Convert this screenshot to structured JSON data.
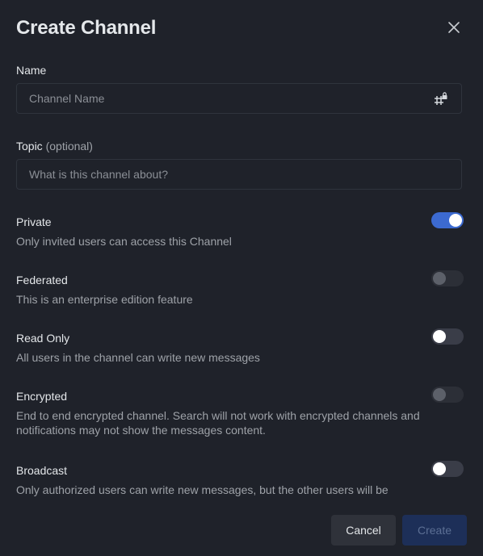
{
  "header": {
    "title": "Create Channel",
    "close_icon": "close-icon"
  },
  "name_field": {
    "label": "Name",
    "placeholder": "Channel Name",
    "value": "",
    "icon": "hash-lock-icon"
  },
  "topic_field": {
    "label": "Topic",
    "label_suffix": "(optional)",
    "placeholder": "What is this channel about?",
    "value": ""
  },
  "options": [
    {
      "title": "Private",
      "description": "Only invited users can access this Channel",
      "enabled": true,
      "disabled": false
    },
    {
      "title": "Federated",
      "description": "This is an enterprise edition feature",
      "enabled": false,
      "disabled": true
    },
    {
      "title": "Read Only",
      "description": "All users in the channel can write new messages",
      "enabled": false,
      "disabled": false
    },
    {
      "title": "Encrypted",
      "description": "End to end encrypted channel. Search will not work with encrypted channels and notifications may not show the messages content.",
      "enabled": false,
      "disabled": true
    },
    {
      "title": "Broadcast",
      "description": "Only authorized users can write new messages, but the other users will be",
      "enabled": false,
      "disabled": false
    }
  ],
  "footer": {
    "cancel_label": "Cancel",
    "create_label": "Create"
  },
  "colors": {
    "background": "#1f222a",
    "accent": "#3c6ad0",
    "create_button_bg": "#1d2f58",
    "cancel_button_bg": "#2f323a"
  }
}
